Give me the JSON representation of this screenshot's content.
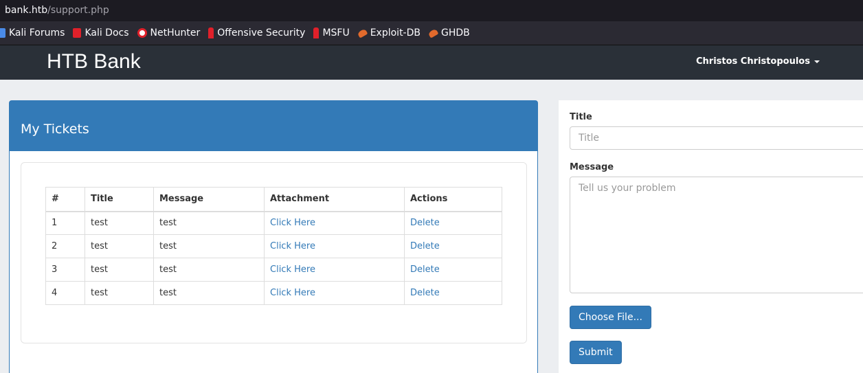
{
  "browser": {
    "url_host": "bank.htb",
    "url_path": "/support.php",
    "bookmarks": [
      {
        "label": "Kali Forums",
        "icon": "kali-forums-icon",
        "color": "#4a8be8"
      },
      {
        "label": "Kali Docs",
        "icon": "kali-docs-icon",
        "color": "#e0202a"
      },
      {
        "label": "NetHunter",
        "icon": "nethunter-icon",
        "color": "#e0202a"
      },
      {
        "label": "Offensive Security",
        "icon": "offsec-icon",
        "color": "#e0202a"
      },
      {
        "label": "MSFU",
        "icon": "msfu-icon",
        "color": "#e0202a"
      },
      {
        "label": "Exploit-DB",
        "icon": "exploit-db-icon",
        "color": "#e26a2c"
      },
      {
        "label": "GHDB",
        "icon": "ghdb-icon",
        "color": "#e26a2c"
      }
    ]
  },
  "navbar": {
    "brand": "HTB Bank",
    "user": "Christos Christopoulos"
  },
  "tickets": {
    "title": "My Tickets",
    "columns": [
      "#",
      "Title",
      "Message",
      "Attachment",
      "Actions"
    ],
    "rows": [
      {
        "num": "1",
        "title": "test",
        "message": "test",
        "attachment": "Click Here",
        "action": "Delete"
      },
      {
        "num": "2",
        "title": "test",
        "message": "test",
        "attachment": "Click Here",
        "action": "Delete"
      },
      {
        "num": "3",
        "title": "test",
        "message": "test",
        "attachment": "Click Here",
        "action": "Delete"
      },
      {
        "num": "4",
        "title": "test",
        "message": "test",
        "attachment": "Click Here",
        "action": "Delete"
      }
    ]
  },
  "form": {
    "title_label": "Title",
    "title_placeholder": "Title",
    "message_label": "Message",
    "message_placeholder": "Tell us your problem",
    "file_button": "Choose File...",
    "submit_button": "Submit"
  },
  "colors": {
    "primary": "#337ab7",
    "navbar": "#2a3038"
  }
}
